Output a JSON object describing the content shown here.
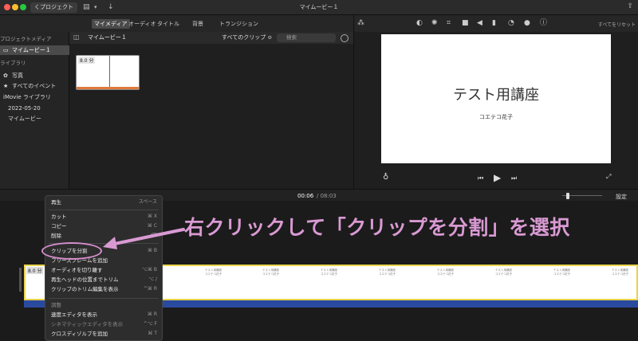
{
  "titlebar": {
    "back_label": "くプロジェクト",
    "title": "マイムービー１"
  },
  "browser_tabs": [
    {
      "label": "マイメディア",
      "active": true
    },
    {
      "label": "オーディオ",
      "active": false
    },
    {
      "label": "タイトル",
      "active": false
    },
    {
      "label": "背景",
      "active": false
    },
    {
      "label": "トランジション",
      "active": false
    }
  ],
  "sidebar": {
    "items": [
      {
        "label": "プロジェクトメディア",
        "type": "head"
      },
      {
        "label": "マイムービー１",
        "type": "selected"
      },
      {
        "label": "ライブラリ",
        "type": "head"
      },
      {
        "label": "写真",
        "type": "item"
      },
      {
        "label": "すべてのイベント",
        "type": "item"
      },
      {
        "label": "iMovie ライブラリ",
        "type": "item"
      },
      {
        "label": "2022-05-20",
        "type": "item"
      },
      {
        "label": "マイムービー",
        "type": "item"
      }
    ]
  },
  "browser": {
    "title": "マイムービー１",
    "filter": "すべてのクリップ ≎",
    "search_placeholder": "検索",
    "clip_duration": "8.0 分"
  },
  "viewer": {
    "reset_label": "すべてをリセット",
    "slide_title": "テスト用講座",
    "slide_subtitle": "コエテコ花子"
  },
  "timeline_header": {
    "current_time": "00:06",
    "total_time": "/ 08:03",
    "settings_label": "設定"
  },
  "timeline": {
    "clip_duration": "8.0 分"
  },
  "context_menu": {
    "items": [
      {
        "label": "再生",
        "shortcut": "スペース",
        "disabled": false
      },
      {
        "label": "カット",
        "shortcut": "⌘ X",
        "disabled": false
      },
      {
        "label": "コピー",
        "shortcut": "⌘ C",
        "disabled": false
      },
      {
        "label": "削除",
        "shortcut": "⌫",
        "disabled": false
      },
      {
        "label": "クリップを分割",
        "shortcut": "⌘ B",
        "disabled": false
      },
      {
        "label": "フリーズフレームを追加",
        "shortcut": "",
        "disabled": false
      },
      {
        "label": "オーディオを切り離す",
        "shortcut": "⌥⌘ B",
        "disabled": false
      },
      {
        "label": "再生ヘッドの位置までトリム",
        "shortcut": "⌥ /",
        "disabled": false
      },
      {
        "label": "クリップのトリム編集を表示",
        "shortcut": "^⌘ R",
        "disabled": false
      },
      {
        "label": "調整",
        "shortcut": "",
        "disabled": true
      },
      {
        "label": "速度エディタを表示",
        "shortcut": "⌘ R",
        "disabled": false
      },
      {
        "label": "シネマティックエディタを表示",
        "shortcut": "^⌥ F",
        "disabled": true
      },
      {
        "label": "クロスディゾルブを追加",
        "shortcut": "⌘ T",
        "disabled": false
      }
    ]
  },
  "annotation": {
    "text": "右クリックして「クリップを分割」を選択",
    "color": "#d99ad3"
  }
}
